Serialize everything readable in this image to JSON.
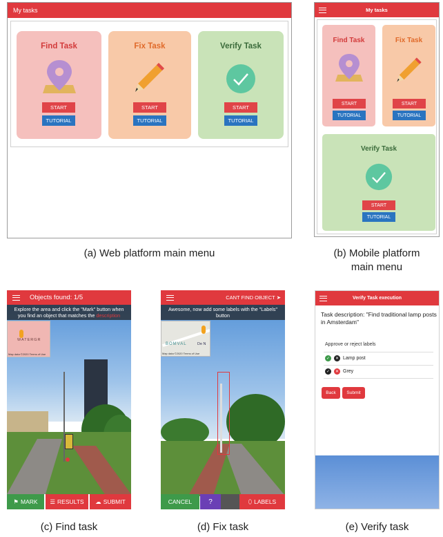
{
  "web_menu": {
    "title": "My tasks",
    "cards": [
      {
        "title": "Find Task",
        "start": "START",
        "tutorial": "TUTORIAL",
        "bg": "#f5c0bd",
        "title_color": "#d23a3a"
      },
      {
        "title": "Fix Task",
        "start": "START",
        "tutorial": "TUTORIAL",
        "bg": "#f8c9a8",
        "title_color": "#e06a2a"
      },
      {
        "title": "Verify Task",
        "start": "START",
        "tutorial": "TUTORIAL",
        "bg": "#c9e3b8",
        "title_color": "#3a6a3a"
      }
    ]
  },
  "mobile_menu": {
    "title": "My tasks",
    "cards": [
      {
        "title": "Find Task",
        "start": "START",
        "tutorial": "TUTORIAL"
      },
      {
        "title": "Fix Task",
        "start": "START",
        "tutorial": "TUTORIAL"
      },
      {
        "title": "Verify Task",
        "start": "START",
        "tutorial": "TUTORIAL"
      }
    ]
  },
  "find_task": {
    "header": "Objects found: 1/5",
    "instruction_1": "Explore the area and click the \"Mark\" button when",
    "instruction_2": "you find an object that matches the",
    "instruction_highlight": "description",
    "map_label": "WATERGR",
    "map_footer": "Map data ©2020   Terms of Use",
    "mark": "MARK",
    "results": "RESULTS",
    "submit": "SUBMIT"
  },
  "fix_task": {
    "header": "CANT FIND OBJECT",
    "instruction_1": "Awesome, now add some labels with the \"Labels\"",
    "instruction_2": "button",
    "map_label_1": "BOMVAL",
    "map_label_2": "De N",
    "map_footer": "Map data ©2020   Terms of Use",
    "cancel": "CANCEL",
    "help": "?",
    "labels": "LABELS"
  },
  "verify_task": {
    "header": "Verify Task execution",
    "description": "Task description: \"Find traditional lamp posts in Amsterdam\"",
    "subheading": "Approve or reject labels",
    "labels": [
      "Lamp post",
      "Grey"
    ],
    "back": "Back",
    "submit": "Submit"
  },
  "captions": {
    "a": "(a) Web platform main menu",
    "b_1": "(b) Mobile platform",
    "b_2": "main menu",
    "c": "(c) Find task",
    "d": "(d) Fix task",
    "e": "(e) Verify task"
  },
  "colors": {
    "accent_red": "#e0393e",
    "button_blue": "#2a74c0",
    "mark_green": "#3e9a4a",
    "help_purple": "#6a3fb5"
  }
}
